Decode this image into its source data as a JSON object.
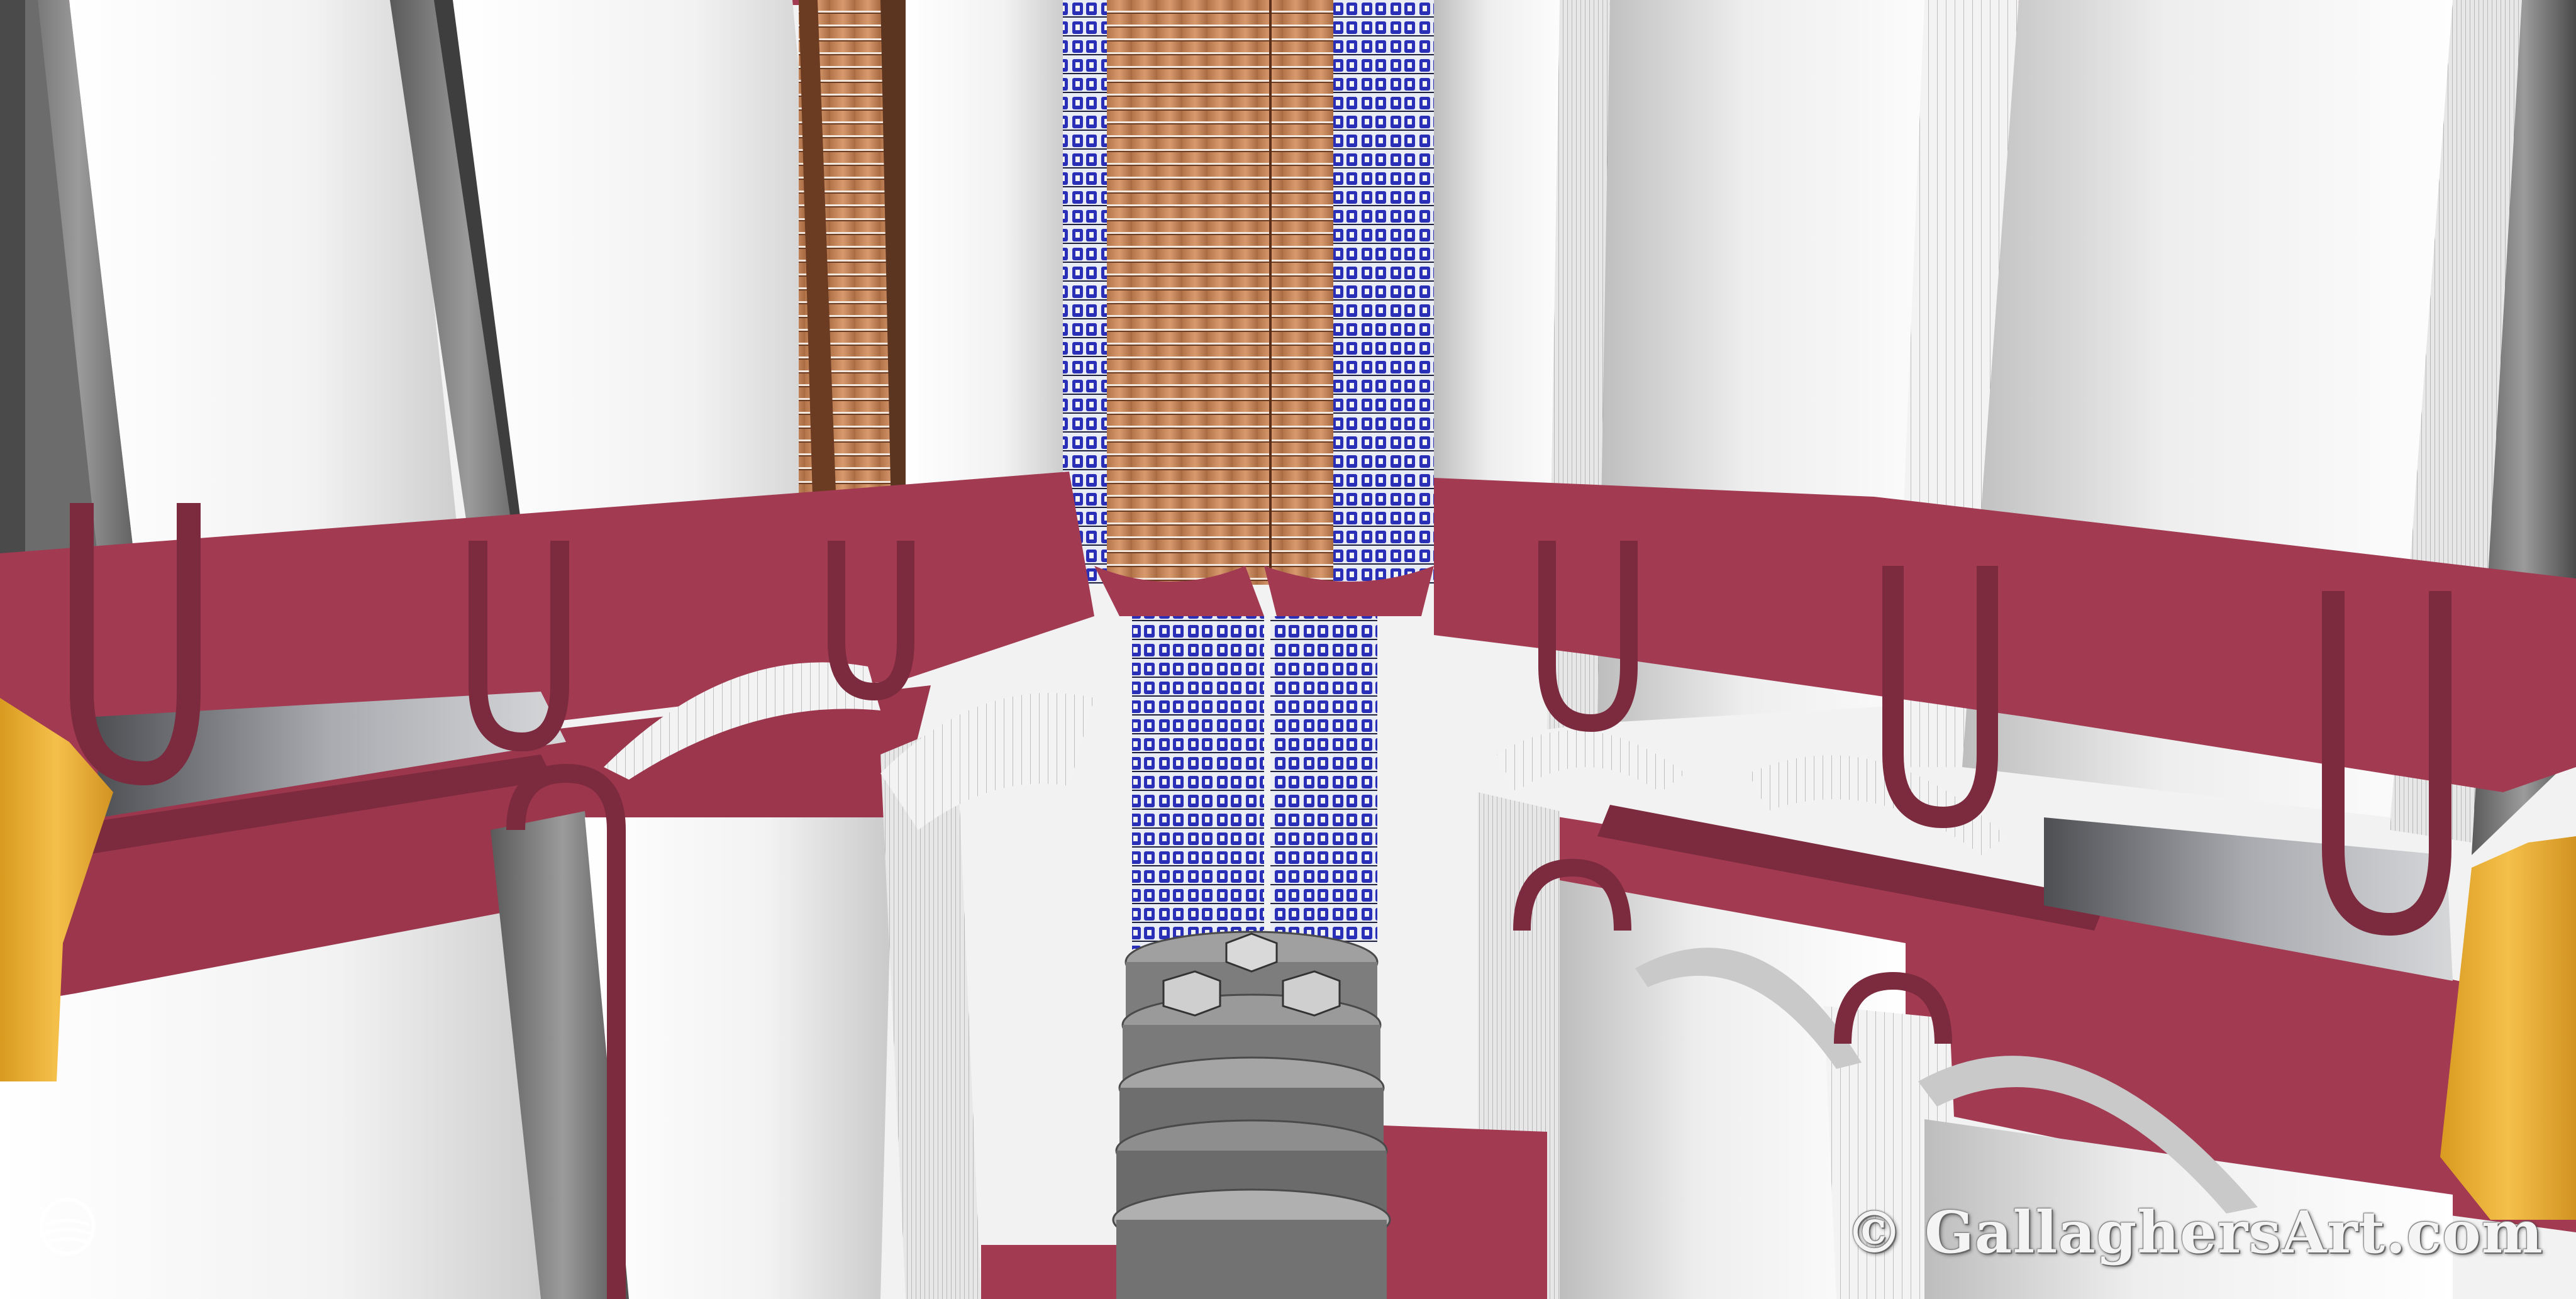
{
  "watermark": {
    "text": "© GallaghersArt.com"
  },
  "logo": {
    "icon": "shell-logo-icon"
  },
  "palette": {
    "background_white": "#f1f1f1",
    "crimson_band": "#a23a52",
    "crimson_dark": "#7c2a3d",
    "copper_rings": "#c98a5e",
    "blue_modules": "#2a2fb8",
    "gray_discs": "#8f8f8f",
    "yellow_supports": "#f0b63a"
  }
}
